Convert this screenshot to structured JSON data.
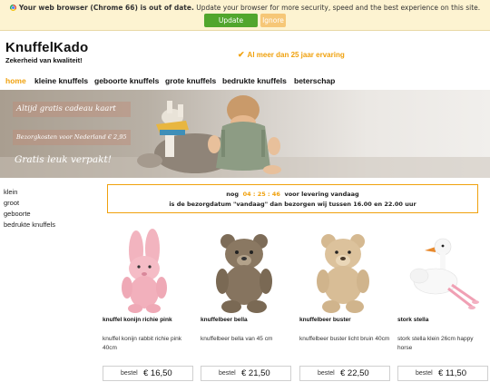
{
  "update_bar": {
    "bold_text": "Your web browser (Chrome 66) is out of date.",
    "text": " Update your browser for more security, speed and the best experience on this site.",
    "update_button": "Update browser",
    "ignore_button": "Ignore"
  },
  "header": {
    "logo": "KnuffelKado",
    "tagline": "Zekerheid van kwaliteit!",
    "usp": "Al meer dan 25 jaar ervaring",
    "flag_icon": "uk-flag-icon"
  },
  "nav": [
    "home",
    "kleine knuffels",
    "geboorte knuffels",
    "grote knuffels",
    "bedrukte knuffels",
    "beterschap"
  ],
  "hero": {
    "label1": "Altijd gratis cadeau kaart",
    "label2": "Bezorgkosten voor Nederland € 2,95",
    "label3": "Gratis leuk verpakt!"
  },
  "sidebar": [
    "klein",
    "groot",
    "geboorte",
    "bedrukte knuffels"
  ],
  "delivery": {
    "prefix": "nog",
    "timer": "04 : 25 : 46",
    "suffix": "voor levering vandaag",
    "line2": "is de bezorgdatum \"vandaag\" dan bezorgen wij tussen 16.00 en 22.00 uur"
  },
  "order_label": "bestel",
  "products": [
    {
      "name": "knuffel konijn richie pink",
      "desc": "knuffel konijn rabbit richie pink 40cm",
      "price": "€ 16,50"
    },
    {
      "name": "knuffelbeer bella",
      "desc": "knuffelbeer bella van 45 cm",
      "price": "€ 21,50"
    },
    {
      "name": "knuffelbeer buster",
      "desc": "knuffelbeer buster licht bruin 40cm",
      "price": "€ 22,50"
    },
    {
      "name": "stork stella",
      "desc": "stork stella klein 26cm happy horse",
      "price": "€ 11,50"
    }
  ],
  "colors": {
    "accent": "#f0a10d",
    "update_green": "#51a62d",
    "ignore_orange": "#f6c777",
    "update_bg": "#fdf3d1"
  }
}
